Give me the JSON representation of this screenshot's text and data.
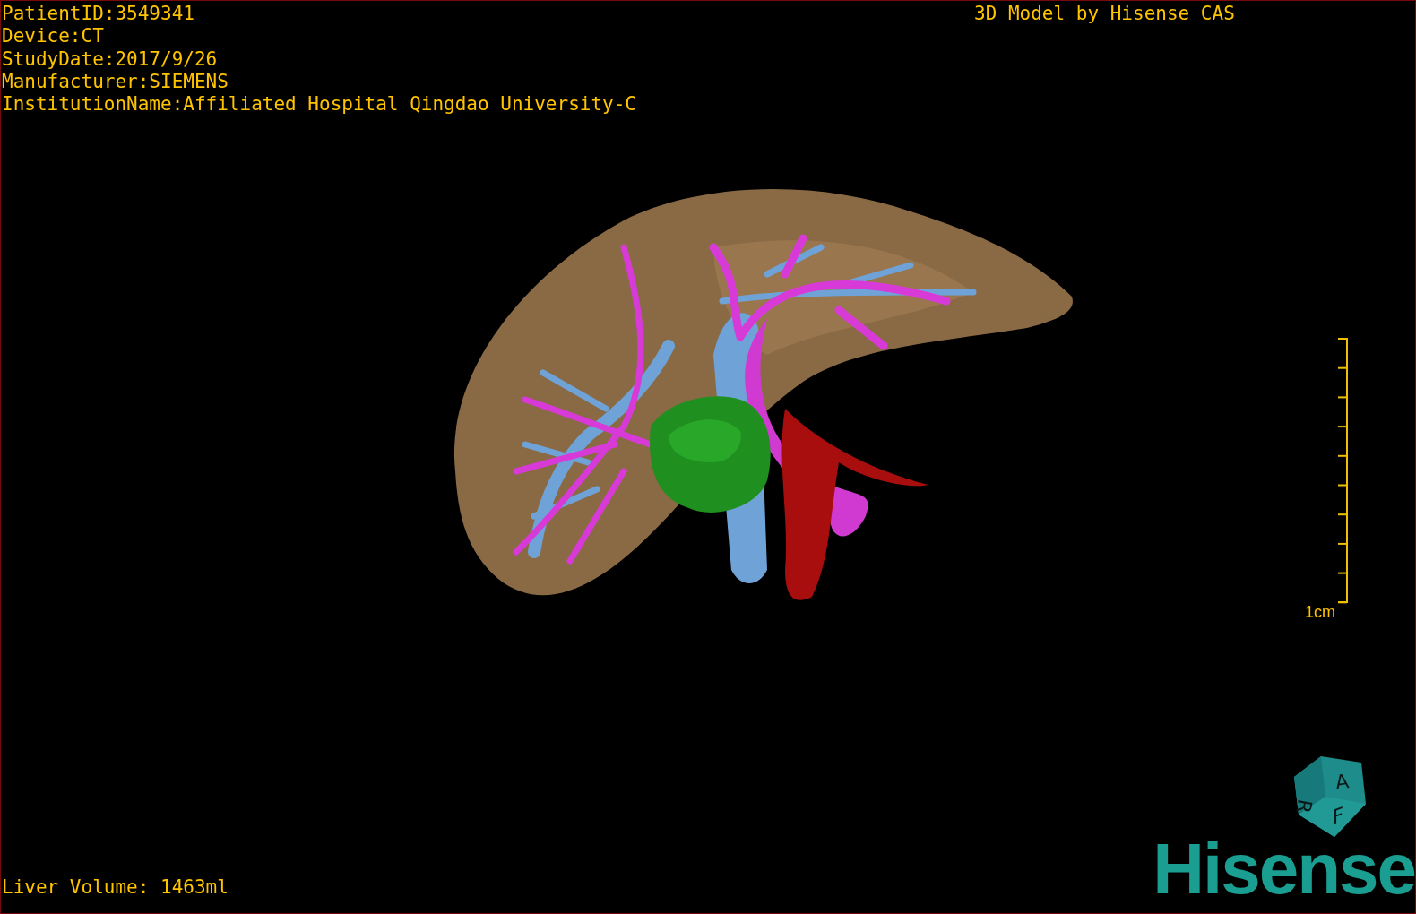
{
  "patient_info": [
    "PatientID:3549341",
    "Device:CT",
    "StudyDate:2017/9/26",
    "Manufacturer:SIEMENS",
    "InstitutionName:Affiliated Hospital Qingdao University-C"
  ],
  "header": "3D Model by Hisense CAS",
  "scale_bar": {
    "label": "1cm"
  },
  "liver_volume": "Liver Volume: 1463ml",
  "orientation_cube": {
    "faces": [
      "A",
      "R",
      "F"
    ]
  },
  "logo": "Hisense"
}
